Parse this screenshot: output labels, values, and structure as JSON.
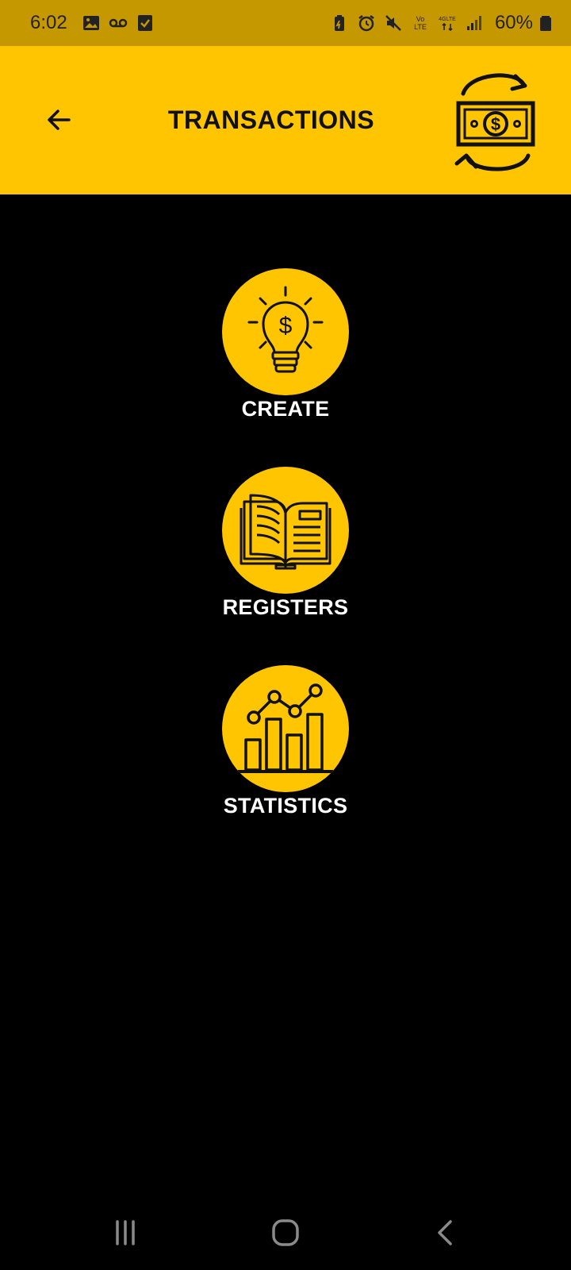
{
  "status_bar": {
    "time": "6:02",
    "battery": "60%",
    "left_icons": [
      "image-icon",
      "voicemail-icon",
      "checkbox-icon"
    ],
    "right_icons": [
      "battery-saver-icon",
      "alarm-icon",
      "mute-icon",
      "volte-icon",
      "4g-lte-icon",
      "signal-icon",
      "battery-icon"
    ],
    "volte_label": "Vo\nLTE",
    "network_label": "4GLTE"
  },
  "app_bar": {
    "title": "TRANSACTIONS",
    "background": "#ffc500"
  },
  "menu": {
    "items": [
      {
        "label": "CREATE",
        "icon": "lightbulb-dollar-icon"
      },
      {
        "label": "REGISTERS",
        "icon": "open-book-icon"
      },
      {
        "label": "STATISTICS",
        "icon": "bar-chart-icon"
      }
    ],
    "circle_color": "#ffc500"
  },
  "nav_bar": {
    "buttons": [
      "recent-apps-icon",
      "home-icon",
      "back-icon"
    ]
  }
}
